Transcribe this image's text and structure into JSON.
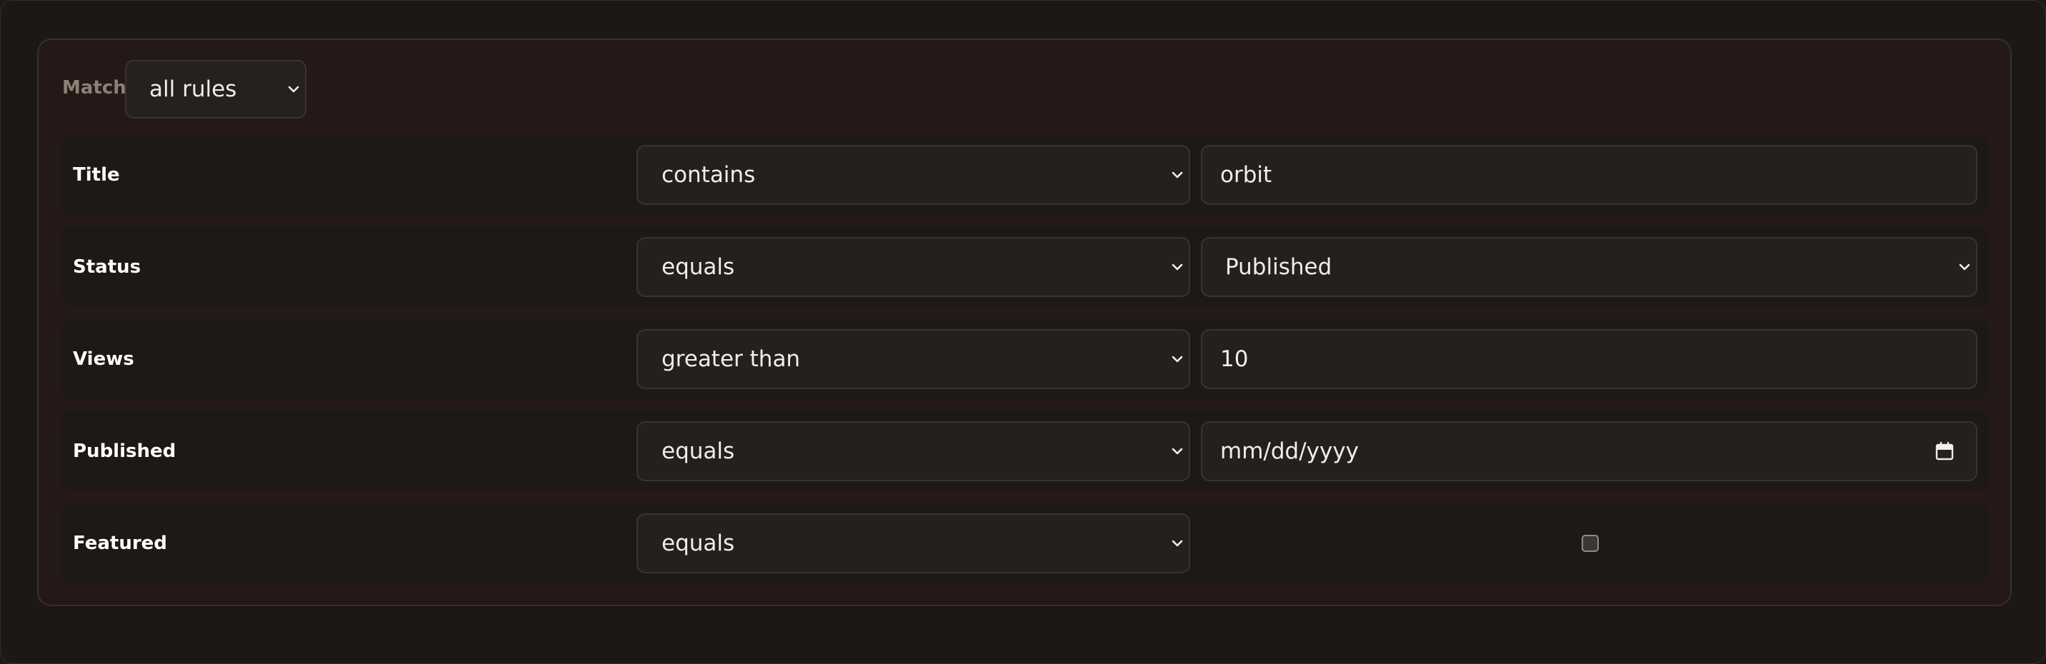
{
  "match": {
    "label": "Match",
    "selected": "all rules"
  },
  "rules": [
    {
      "field": "Title",
      "operator": "contains",
      "value_type": "text",
      "value": "orbit"
    },
    {
      "field": "Status",
      "operator": "equals",
      "value_type": "select",
      "value": "Published"
    },
    {
      "field": "Views",
      "operator": "greater than",
      "value_type": "number",
      "value": "10"
    },
    {
      "field": "Published",
      "operator": "equals",
      "value_type": "date",
      "value": "mm/dd/yyyy"
    },
    {
      "field": "Featured",
      "operator": "equals",
      "value_type": "checkbox",
      "checked": false
    }
  ],
  "icons": {
    "select": "chevron-down-icon",
    "date": "calendar-icon"
  }
}
